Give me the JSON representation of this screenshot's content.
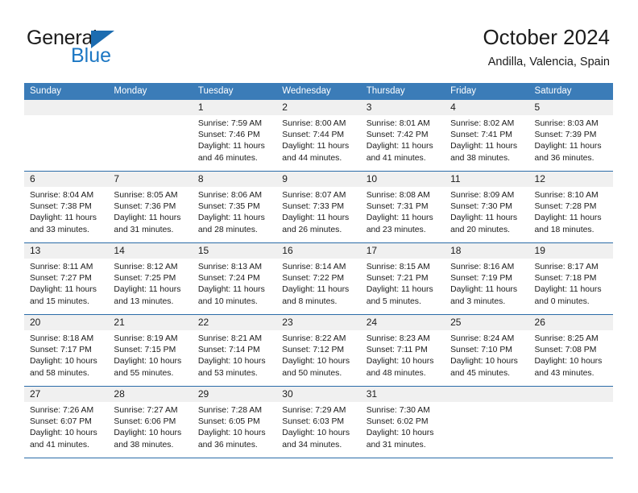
{
  "brand": {
    "name_top": "General",
    "name_bottom": "Blue",
    "accent_color": "#1c77c3",
    "triangle_color": "#1c6cb0"
  },
  "header": {
    "title": "October 2024",
    "subtitle": "Andilla, Valencia, Spain"
  },
  "theme": {
    "header_row_bg": "#3b7cb8",
    "week_divider": "#2b6ca8",
    "daynum_bg": "#f0f0f0",
    "text": "#1b1b1b"
  },
  "weekdays": [
    "Sunday",
    "Monday",
    "Tuesday",
    "Wednesday",
    "Thursday",
    "Friday",
    "Saturday"
  ],
  "weeks": [
    [
      {
        "day": "",
        "sunrise": "",
        "sunset": "",
        "daylight": ""
      },
      {
        "day": "",
        "sunrise": "",
        "sunset": "",
        "daylight": ""
      },
      {
        "day": "1",
        "sunrise": "Sunrise: 7:59 AM",
        "sunset": "Sunset: 7:46 PM",
        "daylight": "Daylight: 11 hours and 46 minutes."
      },
      {
        "day": "2",
        "sunrise": "Sunrise: 8:00 AM",
        "sunset": "Sunset: 7:44 PM",
        "daylight": "Daylight: 11 hours and 44 minutes."
      },
      {
        "day": "3",
        "sunrise": "Sunrise: 8:01 AM",
        "sunset": "Sunset: 7:42 PM",
        "daylight": "Daylight: 11 hours and 41 minutes."
      },
      {
        "day": "4",
        "sunrise": "Sunrise: 8:02 AM",
        "sunset": "Sunset: 7:41 PM",
        "daylight": "Daylight: 11 hours and 38 minutes."
      },
      {
        "day": "5",
        "sunrise": "Sunrise: 8:03 AM",
        "sunset": "Sunset: 7:39 PM",
        "daylight": "Daylight: 11 hours and 36 minutes."
      }
    ],
    [
      {
        "day": "6",
        "sunrise": "Sunrise: 8:04 AM",
        "sunset": "Sunset: 7:38 PM",
        "daylight": "Daylight: 11 hours and 33 minutes."
      },
      {
        "day": "7",
        "sunrise": "Sunrise: 8:05 AM",
        "sunset": "Sunset: 7:36 PM",
        "daylight": "Daylight: 11 hours and 31 minutes."
      },
      {
        "day": "8",
        "sunrise": "Sunrise: 8:06 AM",
        "sunset": "Sunset: 7:35 PM",
        "daylight": "Daylight: 11 hours and 28 minutes."
      },
      {
        "day": "9",
        "sunrise": "Sunrise: 8:07 AM",
        "sunset": "Sunset: 7:33 PM",
        "daylight": "Daylight: 11 hours and 26 minutes."
      },
      {
        "day": "10",
        "sunrise": "Sunrise: 8:08 AM",
        "sunset": "Sunset: 7:31 PM",
        "daylight": "Daylight: 11 hours and 23 minutes."
      },
      {
        "day": "11",
        "sunrise": "Sunrise: 8:09 AM",
        "sunset": "Sunset: 7:30 PM",
        "daylight": "Daylight: 11 hours and 20 minutes."
      },
      {
        "day": "12",
        "sunrise": "Sunrise: 8:10 AM",
        "sunset": "Sunset: 7:28 PM",
        "daylight": "Daylight: 11 hours and 18 minutes."
      }
    ],
    [
      {
        "day": "13",
        "sunrise": "Sunrise: 8:11 AM",
        "sunset": "Sunset: 7:27 PM",
        "daylight": "Daylight: 11 hours and 15 minutes."
      },
      {
        "day": "14",
        "sunrise": "Sunrise: 8:12 AM",
        "sunset": "Sunset: 7:25 PM",
        "daylight": "Daylight: 11 hours and 13 minutes."
      },
      {
        "day": "15",
        "sunrise": "Sunrise: 8:13 AM",
        "sunset": "Sunset: 7:24 PM",
        "daylight": "Daylight: 11 hours and 10 minutes."
      },
      {
        "day": "16",
        "sunrise": "Sunrise: 8:14 AM",
        "sunset": "Sunset: 7:22 PM",
        "daylight": "Daylight: 11 hours and 8 minutes."
      },
      {
        "day": "17",
        "sunrise": "Sunrise: 8:15 AM",
        "sunset": "Sunset: 7:21 PM",
        "daylight": "Daylight: 11 hours and 5 minutes."
      },
      {
        "day": "18",
        "sunrise": "Sunrise: 8:16 AM",
        "sunset": "Sunset: 7:19 PM",
        "daylight": "Daylight: 11 hours and 3 minutes."
      },
      {
        "day": "19",
        "sunrise": "Sunrise: 8:17 AM",
        "sunset": "Sunset: 7:18 PM",
        "daylight": "Daylight: 11 hours and 0 minutes."
      }
    ],
    [
      {
        "day": "20",
        "sunrise": "Sunrise: 8:18 AM",
        "sunset": "Sunset: 7:17 PM",
        "daylight": "Daylight: 10 hours and 58 minutes."
      },
      {
        "day": "21",
        "sunrise": "Sunrise: 8:19 AM",
        "sunset": "Sunset: 7:15 PM",
        "daylight": "Daylight: 10 hours and 55 minutes."
      },
      {
        "day": "22",
        "sunrise": "Sunrise: 8:21 AM",
        "sunset": "Sunset: 7:14 PM",
        "daylight": "Daylight: 10 hours and 53 minutes."
      },
      {
        "day": "23",
        "sunrise": "Sunrise: 8:22 AM",
        "sunset": "Sunset: 7:12 PM",
        "daylight": "Daylight: 10 hours and 50 minutes."
      },
      {
        "day": "24",
        "sunrise": "Sunrise: 8:23 AM",
        "sunset": "Sunset: 7:11 PM",
        "daylight": "Daylight: 10 hours and 48 minutes."
      },
      {
        "day": "25",
        "sunrise": "Sunrise: 8:24 AM",
        "sunset": "Sunset: 7:10 PM",
        "daylight": "Daylight: 10 hours and 45 minutes."
      },
      {
        "day": "26",
        "sunrise": "Sunrise: 8:25 AM",
        "sunset": "Sunset: 7:08 PM",
        "daylight": "Daylight: 10 hours and 43 minutes."
      }
    ],
    [
      {
        "day": "27",
        "sunrise": "Sunrise: 7:26 AM",
        "sunset": "Sunset: 6:07 PM",
        "daylight": "Daylight: 10 hours and 41 minutes."
      },
      {
        "day": "28",
        "sunrise": "Sunrise: 7:27 AM",
        "sunset": "Sunset: 6:06 PM",
        "daylight": "Daylight: 10 hours and 38 minutes."
      },
      {
        "day": "29",
        "sunrise": "Sunrise: 7:28 AM",
        "sunset": "Sunset: 6:05 PM",
        "daylight": "Daylight: 10 hours and 36 minutes."
      },
      {
        "day": "30",
        "sunrise": "Sunrise: 7:29 AM",
        "sunset": "Sunset: 6:03 PM",
        "daylight": "Daylight: 10 hours and 34 minutes."
      },
      {
        "day": "31",
        "sunrise": "Sunrise: 7:30 AM",
        "sunset": "Sunset: 6:02 PM",
        "daylight": "Daylight: 10 hours and 31 minutes."
      },
      {
        "day": "",
        "sunrise": "",
        "sunset": "",
        "daylight": ""
      },
      {
        "day": "",
        "sunrise": "",
        "sunset": "",
        "daylight": ""
      }
    ]
  ]
}
